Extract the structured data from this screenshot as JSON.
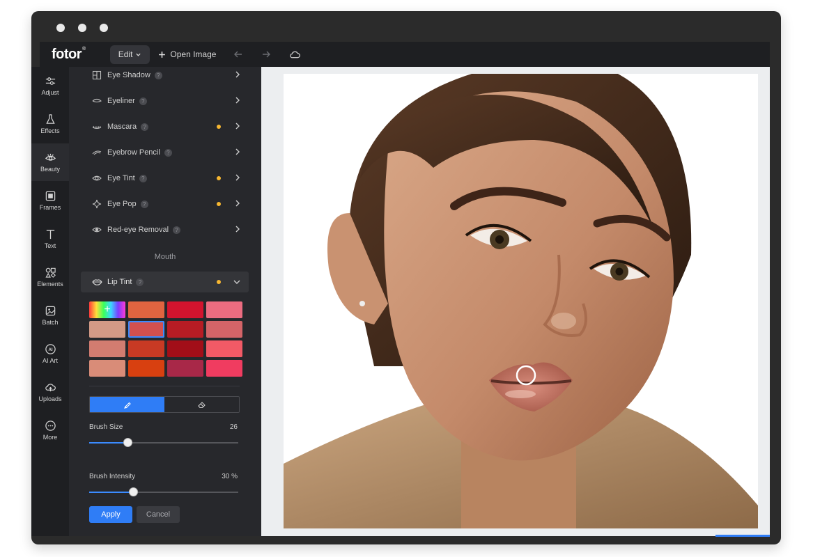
{
  "window": {
    "dot_color": "#e9e9e9"
  },
  "topbar": {
    "logo": "fotor",
    "logo_mark": "®",
    "edit_label": "Edit",
    "open_image_label": "Open Image",
    "icons": [
      "undo-icon",
      "redo-icon",
      "cloud-icon"
    ]
  },
  "sidebar": {
    "items": [
      {
        "label": "Adjust",
        "icon": "sliders-icon"
      },
      {
        "label": "Effects",
        "icon": "flask-icon"
      },
      {
        "label": "Beauty",
        "icon": "eye-icon",
        "active": true
      },
      {
        "label": "Frames",
        "icon": "frame-icon"
      },
      {
        "label": "Text",
        "icon": "text-icon"
      },
      {
        "label": "Elements",
        "icon": "shapes-icon"
      },
      {
        "label": "Batch",
        "icon": "batch-icon"
      },
      {
        "label": "AI Art",
        "icon": "ai-icon"
      },
      {
        "label": "Uploads",
        "icon": "upload-icon"
      },
      {
        "label": "More",
        "icon": "more-icon"
      }
    ]
  },
  "panel": {
    "help_glyph": "?",
    "eye_tools": [
      {
        "label": "Eye Shadow",
        "icon": "eye-shadow-icon",
        "status": false
      },
      {
        "label": "Eyeliner",
        "icon": "eyeliner-icon",
        "status": false
      },
      {
        "label": "Mascara",
        "icon": "mascara-icon",
        "status": true
      },
      {
        "label": "Eyebrow Pencil",
        "icon": "eyebrow-icon",
        "status": false
      },
      {
        "label": "Eye Tint",
        "icon": "eye-tint-icon",
        "status": true
      },
      {
        "label": "Eye Pop",
        "icon": "sparkle-icon",
        "status": true
      },
      {
        "label": "Red-eye Removal",
        "icon": "red-eye-icon",
        "status": false
      }
    ],
    "mouth_section": "Mouth",
    "lip_tint": {
      "label": "Lip Tint",
      "status": true,
      "expanded": true
    },
    "swatches": [
      "custom",
      "#e06440",
      "#d2142e",
      "#ec6c80",
      "#d39a86",
      "#d2504e",
      "#b71c24",
      "#d46468",
      "#d27c70",
      "#c83a24",
      "#a20e18",
      "#f25a66",
      "#d98c78",
      "#d84010",
      "#a82848",
      "#f03c60"
    ],
    "selected_swatch": 5,
    "brush_size": {
      "label": "Brush Size",
      "value": "26",
      "fraction": 0.26
    },
    "brush_intensity": {
      "label": "Brush Intensity",
      "value": "30 %",
      "fraction": 0.3
    },
    "apply_label": "Apply",
    "cancel_label": "Cancel"
  },
  "colors": {
    "accent": "#2f7df6",
    "status_dot": "#f7b731",
    "bg": "#27282c"
  }
}
